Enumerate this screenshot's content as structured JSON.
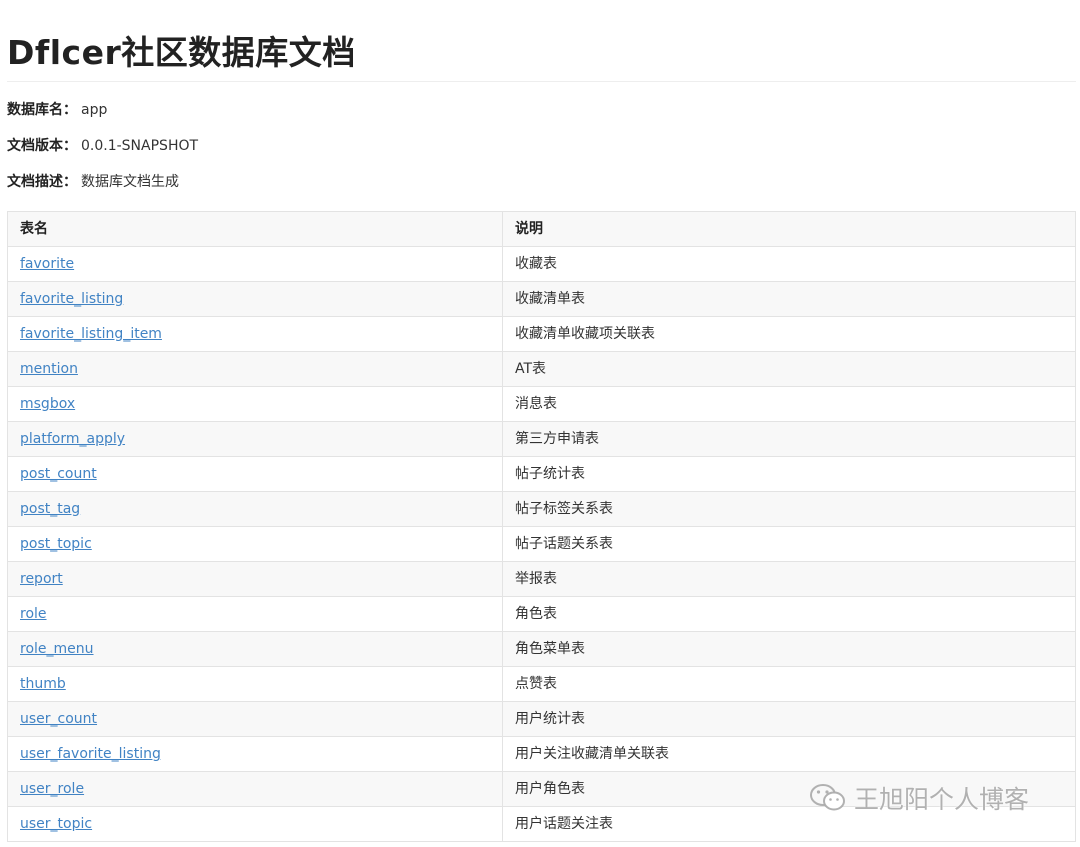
{
  "page": {
    "title": "Dflcer社区数据库文档"
  },
  "meta": {
    "db_name_label": "数据库名：",
    "db_name_value": "app",
    "doc_version_label": "文档版本：",
    "doc_version_value": "0.0.1-SNAPSHOT",
    "doc_desc_label": "文档描述：",
    "doc_desc_value": "数据库文档生成"
  },
  "table": {
    "headers": [
      "表名",
      "说明"
    ],
    "rows": [
      {
        "name": "favorite",
        "desc": "收藏表"
      },
      {
        "name": "favorite_listing",
        "desc": "收藏清单表"
      },
      {
        "name": "favorite_listing_item",
        "desc": "收藏清单收藏项关联表"
      },
      {
        "name": "mention",
        "desc": "AT表"
      },
      {
        "name": "msgbox",
        "desc": "消息表"
      },
      {
        "name": "platform_apply",
        "desc": "第三方申请表"
      },
      {
        "name": "post_count",
        "desc": "帖子统计表"
      },
      {
        "name": "post_tag",
        "desc": "帖子标签关系表"
      },
      {
        "name": "post_topic",
        "desc": "帖子话题关系表"
      },
      {
        "name": "report",
        "desc": "举报表"
      },
      {
        "name": "role",
        "desc": "角色表"
      },
      {
        "name": "role_menu",
        "desc": "角色菜单表"
      },
      {
        "name": "thumb",
        "desc": "点赞表"
      },
      {
        "name": "user_count",
        "desc": "用户统计表"
      },
      {
        "name": "user_favorite_listing",
        "desc": "用户关注收藏清单关联表"
      },
      {
        "name": "user_role",
        "desc": "用户角色表"
      },
      {
        "name": "user_topic",
        "desc": "用户话题关注表"
      }
    ]
  },
  "watermark": {
    "text": "王旭阳个人博客",
    "icon": "wechat-icon"
  }
}
